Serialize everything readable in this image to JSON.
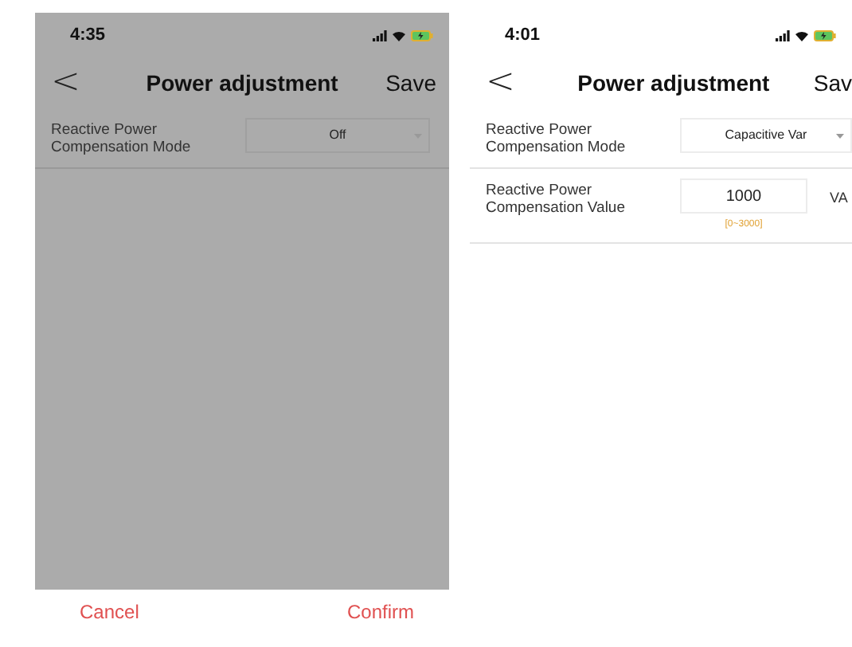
{
  "screens": [
    {
      "dimmed": true,
      "status_bar": {
        "time": "4:35"
      },
      "nav": {
        "back": "<",
        "title": "Power adjustment",
        "action": "Save"
      },
      "rows": [
        {
          "label": "Reactive Power Compensation Mode",
          "kind": "select",
          "value": "Off"
        }
      ],
      "picker": {
        "cancel": "Cancel",
        "confirm": "Confirm"
      }
    },
    {
      "dimmed": false,
      "status_bar": {
        "time": "4:01"
      },
      "nav": {
        "back": "<",
        "title": "Power adjustment",
        "action": "Sav"
      },
      "rows": [
        {
          "label": "Reactive Power Compensation Mode",
          "kind": "select",
          "value": "Capacitive Var"
        },
        {
          "label": "Reactive Power Compensation Value",
          "kind": "input",
          "value": "1000",
          "unit": "VA",
          "range": "[0~3000]"
        }
      ]
    }
  ]
}
